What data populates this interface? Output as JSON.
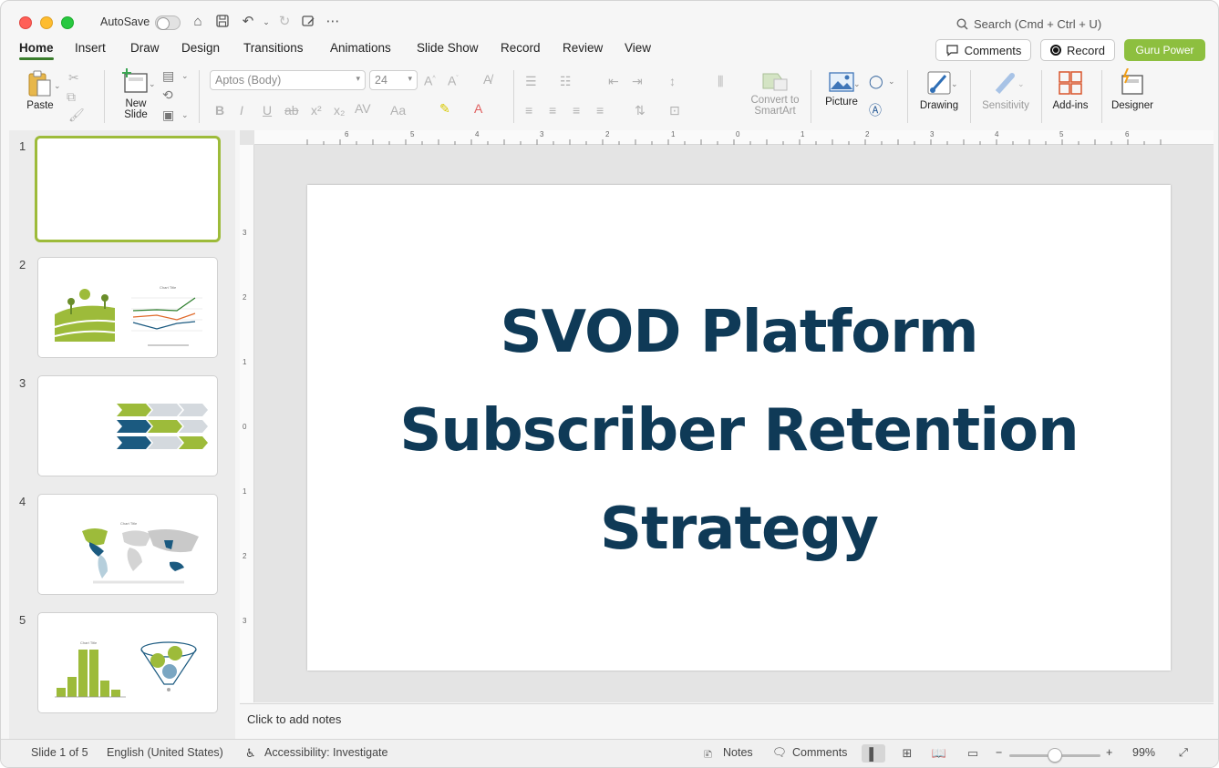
{
  "titlebar": {
    "autosave_label": "AutoSave",
    "search_placeholder": "Search (Cmd + Ctrl + U)"
  },
  "tabs": [
    "Home",
    "Insert",
    "Draw",
    "Design",
    "Transitions",
    "Animations",
    "Slide Show",
    "Record",
    "Review",
    "View"
  ],
  "header_buttons": {
    "comments": "Comments",
    "record": "Record",
    "guru": "Guru Power"
  },
  "ribbon": {
    "paste": "Paste",
    "new_slide_1": "New",
    "new_slide_2": "Slide",
    "font_name": "Aptos (Body)",
    "font_size": "24",
    "convert_1": "Convert to",
    "convert_2": "SmartArt",
    "picture": "Picture",
    "drawing": "Drawing",
    "sensitivity": "Sensitivity",
    "addins": "Add-ins",
    "designer": "Designer"
  },
  "thumbnails": {
    "numbers": [
      "1",
      "2",
      "3",
      "4",
      "5"
    ],
    "chart_title": "Chart Title"
  },
  "slide": {
    "title_line1": "SVOD Platform",
    "title_line2": "Subscriber Retention",
    "title_line3": "Strategy"
  },
  "ruler": {
    "h_labels": [
      "6",
      "5",
      "4",
      "3",
      "2",
      "1",
      "0",
      "1",
      "2",
      "3",
      "4",
      "5",
      "6"
    ],
    "v_labels": [
      "3",
      "2",
      "1",
      "0",
      "1",
      "2",
      "3"
    ]
  },
  "notes_placeholder": "Click to add notes",
  "status": {
    "slide_info": "Slide 1 of 5",
    "language": "English (United States)",
    "accessibility": "Accessibility: Investigate",
    "notes": "Notes",
    "comments": "Comments",
    "zoom": "99%"
  },
  "colors": {
    "title_navy": "#0f3a57",
    "accent_green": "#9dbb3a",
    "guru_green": "#8dbf3f",
    "tab_underline": "#3a7d2c"
  }
}
